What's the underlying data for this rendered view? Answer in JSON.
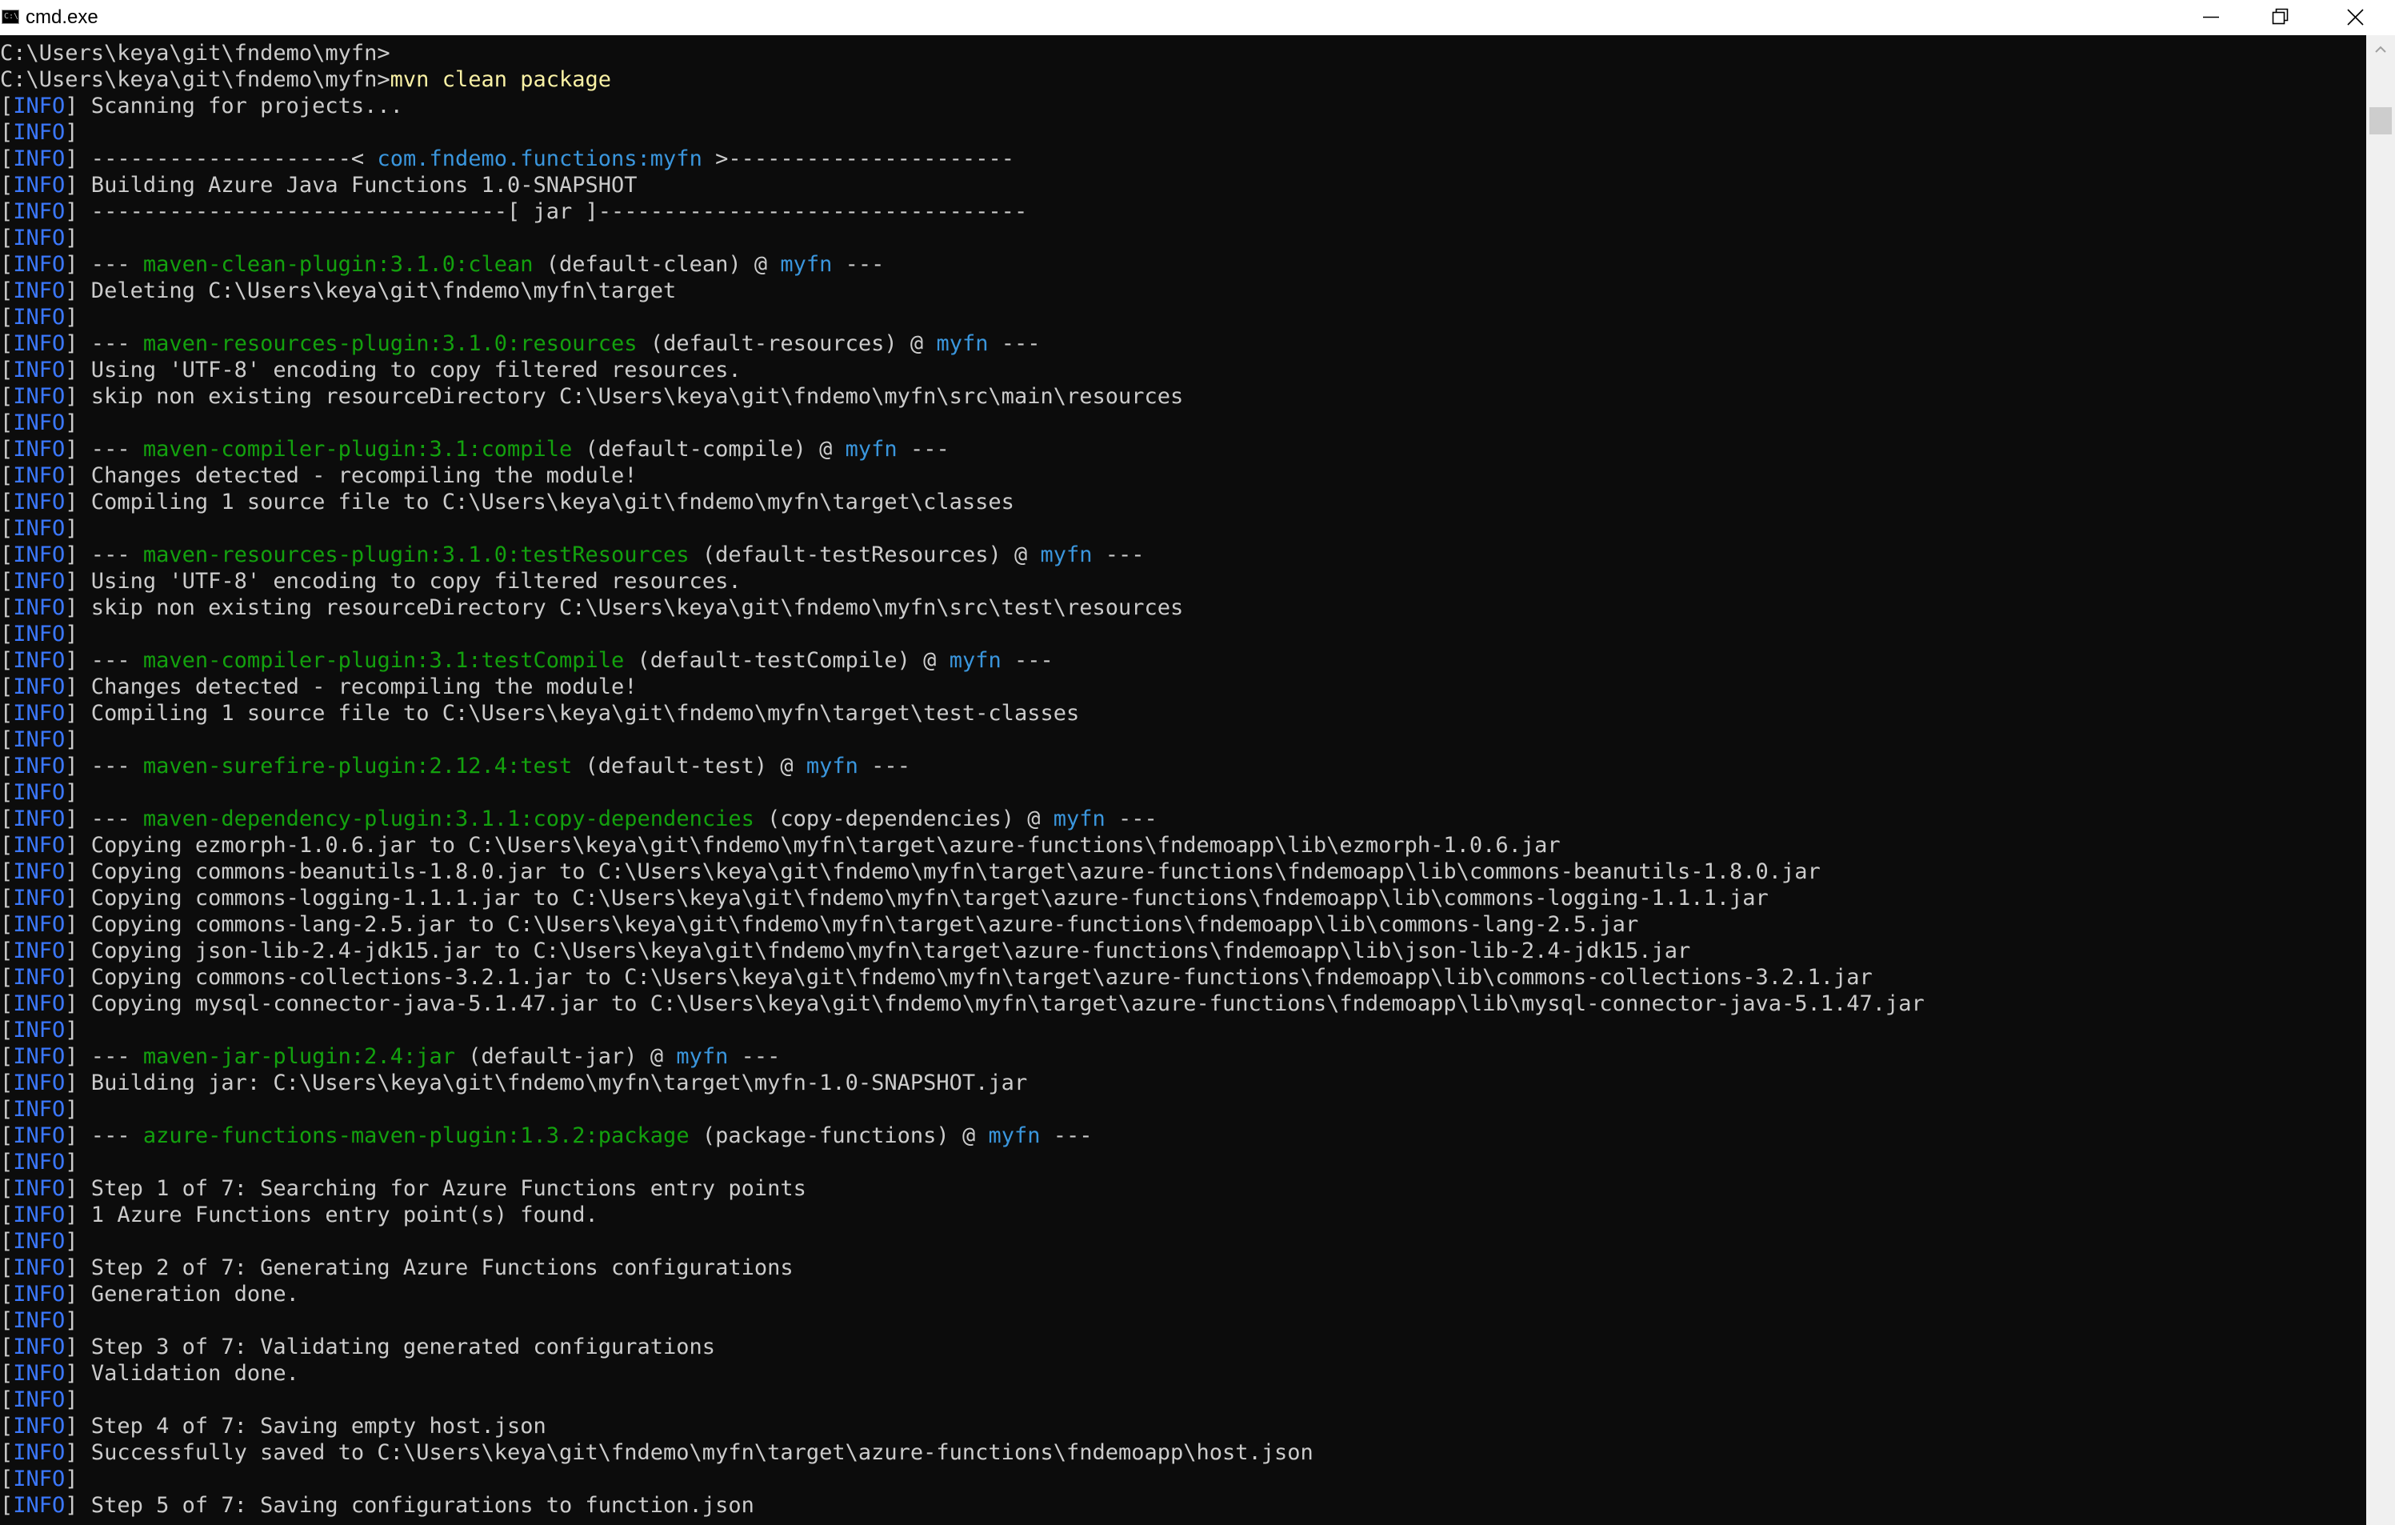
{
  "window": {
    "title": "cmd.exe",
    "icon_label": "C:\\",
    "icon": "console-icon",
    "controls": [
      "minimize-icon",
      "restore-icon",
      "close-icon"
    ]
  },
  "colors": {
    "background": "#0c0c0c",
    "text": "#cccccc",
    "command": "#f9f1a5",
    "info": "#3b78ff",
    "plugin": "#13a10e",
    "artifact": "#3a96dd"
  },
  "terminal": {
    "lines": [
      [
        [
          "prompt",
          "C:\\Users\\keya\\git\\fndemo\\myfn>"
        ]
      ],
      [
        [
          "prompt",
          "C:\\Users\\keya\\git\\fndemo\\myfn>"
        ],
        [
          "cmd",
          "mvn clean package"
        ]
      ],
      [
        [
          "text",
          "["
        ],
        [
          "info",
          "INFO"
        ],
        [
          "text",
          "] Scanning for projects..."
        ]
      ],
      [
        [
          "text",
          "["
        ],
        [
          "info",
          "INFO"
        ],
        [
          "text",
          "]"
        ]
      ],
      [
        [
          "text",
          "["
        ],
        [
          "info",
          "INFO"
        ],
        [
          "text",
          "] --------------------< "
        ],
        [
          "artifact",
          "com.fndemo.functions:myfn"
        ],
        [
          "text",
          " >----------------------"
        ]
      ],
      [
        [
          "text",
          "["
        ],
        [
          "info",
          "INFO"
        ],
        [
          "text",
          "] Building Azure Java Functions 1.0-SNAPSHOT"
        ]
      ],
      [
        [
          "text",
          "["
        ],
        [
          "info",
          "INFO"
        ],
        [
          "text",
          "] --------------------------------[ jar ]---------------------------------"
        ]
      ],
      [
        [
          "text",
          "["
        ],
        [
          "info",
          "INFO"
        ],
        [
          "text",
          "]"
        ]
      ],
      [
        [
          "text",
          "["
        ],
        [
          "info",
          "INFO"
        ],
        [
          "text",
          "] --- "
        ],
        [
          "plugin",
          "maven-clean-plugin:3.1.0:clean"
        ],
        [
          "text",
          " (default-clean) @ "
        ],
        [
          "artifact",
          "myfn"
        ],
        [
          "text",
          " ---"
        ]
      ],
      [
        [
          "text",
          "["
        ],
        [
          "info",
          "INFO"
        ],
        [
          "text",
          "] Deleting C:\\Users\\keya\\git\\fndemo\\myfn\\target"
        ]
      ],
      [
        [
          "text",
          "["
        ],
        [
          "info",
          "INFO"
        ],
        [
          "text",
          "]"
        ]
      ],
      [
        [
          "text",
          "["
        ],
        [
          "info",
          "INFO"
        ],
        [
          "text",
          "] --- "
        ],
        [
          "plugin",
          "maven-resources-plugin:3.1.0:resources"
        ],
        [
          "text",
          " (default-resources) @ "
        ],
        [
          "artifact",
          "myfn"
        ],
        [
          "text",
          " ---"
        ]
      ],
      [
        [
          "text",
          "["
        ],
        [
          "info",
          "INFO"
        ],
        [
          "text",
          "] Using 'UTF-8' encoding to copy filtered resources."
        ]
      ],
      [
        [
          "text",
          "["
        ],
        [
          "info",
          "INFO"
        ],
        [
          "text",
          "] skip non existing resourceDirectory C:\\Users\\keya\\git\\fndemo\\myfn\\src\\main\\resources"
        ]
      ],
      [
        [
          "text",
          "["
        ],
        [
          "info",
          "INFO"
        ],
        [
          "text",
          "]"
        ]
      ],
      [
        [
          "text",
          "["
        ],
        [
          "info",
          "INFO"
        ],
        [
          "text",
          "] --- "
        ],
        [
          "plugin",
          "maven-compiler-plugin:3.1:compile"
        ],
        [
          "text",
          " (default-compile) @ "
        ],
        [
          "artifact",
          "myfn"
        ],
        [
          "text",
          " ---"
        ]
      ],
      [
        [
          "text",
          "["
        ],
        [
          "info",
          "INFO"
        ],
        [
          "text",
          "] Changes detected - recompiling the module!"
        ]
      ],
      [
        [
          "text",
          "["
        ],
        [
          "info",
          "INFO"
        ],
        [
          "text",
          "] Compiling 1 source file to C:\\Users\\keya\\git\\fndemo\\myfn\\target\\classes"
        ]
      ],
      [
        [
          "text",
          "["
        ],
        [
          "info",
          "INFO"
        ],
        [
          "text",
          "]"
        ]
      ],
      [
        [
          "text",
          "["
        ],
        [
          "info",
          "INFO"
        ],
        [
          "text",
          "] --- "
        ],
        [
          "plugin",
          "maven-resources-plugin:3.1.0:testResources"
        ],
        [
          "text",
          " (default-testResources) @ "
        ],
        [
          "artifact",
          "myfn"
        ],
        [
          "text",
          " ---"
        ]
      ],
      [
        [
          "text",
          "["
        ],
        [
          "info",
          "INFO"
        ],
        [
          "text",
          "] Using 'UTF-8' encoding to copy filtered resources."
        ]
      ],
      [
        [
          "text",
          "["
        ],
        [
          "info",
          "INFO"
        ],
        [
          "text",
          "] skip non existing resourceDirectory C:\\Users\\keya\\git\\fndemo\\myfn\\src\\test\\resources"
        ]
      ],
      [
        [
          "text",
          "["
        ],
        [
          "info",
          "INFO"
        ],
        [
          "text",
          "]"
        ]
      ],
      [
        [
          "text",
          "["
        ],
        [
          "info",
          "INFO"
        ],
        [
          "text",
          "] --- "
        ],
        [
          "plugin",
          "maven-compiler-plugin:3.1:testCompile"
        ],
        [
          "text",
          " (default-testCompile) @ "
        ],
        [
          "artifact",
          "myfn"
        ],
        [
          "text",
          " ---"
        ]
      ],
      [
        [
          "text",
          "["
        ],
        [
          "info",
          "INFO"
        ],
        [
          "text",
          "] Changes detected - recompiling the module!"
        ]
      ],
      [
        [
          "text",
          "["
        ],
        [
          "info",
          "INFO"
        ],
        [
          "text",
          "] Compiling 1 source file to C:\\Users\\keya\\git\\fndemo\\myfn\\target\\test-classes"
        ]
      ],
      [
        [
          "text",
          "["
        ],
        [
          "info",
          "INFO"
        ],
        [
          "text",
          "]"
        ]
      ],
      [
        [
          "text",
          "["
        ],
        [
          "info",
          "INFO"
        ],
        [
          "text",
          "] --- "
        ],
        [
          "plugin",
          "maven-surefire-plugin:2.12.4:test"
        ],
        [
          "text",
          " (default-test) @ "
        ],
        [
          "artifact",
          "myfn"
        ],
        [
          "text",
          " ---"
        ]
      ],
      [
        [
          "text",
          "["
        ],
        [
          "info",
          "INFO"
        ],
        [
          "text",
          "]"
        ]
      ],
      [
        [
          "text",
          "["
        ],
        [
          "info",
          "INFO"
        ],
        [
          "text",
          "] --- "
        ],
        [
          "plugin",
          "maven-dependency-plugin:3.1.1:copy-dependencies"
        ],
        [
          "text",
          " (copy-dependencies) @ "
        ],
        [
          "artifact",
          "myfn"
        ],
        [
          "text",
          " ---"
        ]
      ],
      [
        [
          "text",
          "["
        ],
        [
          "info",
          "INFO"
        ],
        [
          "text",
          "] Copying ezmorph-1.0.6.jar to C:\\Users\\keya\\git\\fndemo\\myfn\\target\\azure-functions\\fndemoapp\\lib\\ezmorph-1.0.6.jar"
        ]
      ],
      [
        [
          "text",
          "["
        ],
        [
          "info",
          "INFO"
        ],
        [
          "text",
          "] Copying commons-beanutils-1.8.0.jar to C:\\Users\\keya\\git\\fndemo\\myfn\\target\\azure-functions\\fndemoapp\\lib\\commons-beanutils-1.8.0.jar"
        ]
      ],
      [
        [
          "text",
          "["
        ],
        [
          "info",
          "INFO"
        ],
        [
          "text",
          "] Copying commons-logging-1.1.1.jar to C:\\Users\\keya\\git\\fndemo\\myfn\\target\\azure-functions\\fndemoapp\\lib\\commons-logging-1.1.1.jar"
        ]
      ],
      [
        [
          "text",
          "["
        ],
        [
          "info",
          "INFO"
        ],
        [
          "text",
          "] Copying commons-lang-2.5.jar to C:\\Users\\keya\\git\\fndemo\\myfn\\target\\azure-functions\\fndemoapp\\lib\\commons-lang-2.5.jar"
        ]
      ],
      [
        [
          "text",
          "["
        ],
        [
          "info",
          "INFO"
        ],
        [
          "text",
          "] Copying json-lib-2.4-jdk15.jar to C:\\Users\\keya\\git\\fndemo\\myfn\\target\\azure-functions\\fndemoapp\\lib\\json-lib-2.4-jdk15.jar"
        ]
      ],
      [
        [
          "text",
          "["
        ],
        [
          "info",
          "INFO"
        ],
        [
          "text",
          "] Copying commons-collections-3.2.1.jar to C:\\Users\\keya\\git\\fndemo\\myfn\\target\\azure-functions\\fndemoapp\\lib\\commons-collections-3.2.1.jar"
        ]
      ],
      [
        [
          "text",
          "["
        ],
        [
          "info",
          "INFO"
        ],
        [
          "text",
          "] Copying mysql-connector-java-5.1.47.jar to C:\\Users\\keya\\git\\fndemo\\myfn\\target\\azure-functions\\fndemoapp\\lib\\mysql-connector-java-5.1.47.jar"
        ]
      ],
      [
        [
          "text",
          "["
        ],
        [
          "info",
          "INFO"
        ],
        [
          "text",
          "]"
        ]
      ],
      [
        [
          "text",
          "["
        ],
        [
          "info",
          "INFO"
        ],
        [
          "text",
          "] --- "
        ],
        [
          "plugin",
          "maven-jar-plugin:2.4:jar"
        ],
        [
          "text",
          " (default-jar) @ "
        ],
        [
          "artifact",
          "myfn"
        ],
        [
          "text",
          " ---"
        ]
      ],
      [
        [
          "text",
          "["
        ],
        [
          "info",
          "INFO"
        ],
        [
          "text",
          "] Building jar: C:\\Users\\keya\\git\\fndemo\\myfn\\target\\myfn-1.0-SNAPSHOT.jar"
        ]
      ],
      [
        [
          "text",
          "["
        ],
        [
          "info",
          "INFO"
        ],
        [
          "text",
          "]"
        ]
      ],
      [
        [
          "text",
          "["
        ],
        [
          "info",
          "INFO"
        ],
        [
          "text",
          "] --- "
        ],
        [
          "plugin",
          "azure-functions-maven-plugin:1.3.2:package"
        ],
        [
          "text",
          " (package-functions) @ "
        ],
        [
          "artifact",
          "myfn"
        ],
        [
          "text",
          " ---"
        ]
      ],
      [
        [
          "text",
          "["
        ],
        [
          "info",
          "INFO"
        ],
        [
          "text",
          "]"
        ]
      ],
      [
        [
          "text",
          "["
        ],
        [
          "info",
          "INFO"
        ],
        [
          "text",
          "] Step 1 of 7: Searching for Azure Functions entry points"
        ]
      ],
      [
        [
          "text",
          "["
        ],
        [
          "info",
          "INFO"
        ],
        [
          "text",
          "] 1 Azure Functions entry point(s) found."
        ]
      ],
      [
        [
          "text",
          "["
        ],
        [
          "info",
          "INFO"
        ],
        [
          "text",
          "]"
        ]
      ],
      [
        [
          "text",
          "["
        ],
        [
          "info",
          "INFO"
        ],
        [
          "text",
          "] Step 2 of 7: Generating Azure Functions configurations"
        ]
      ],
      [
        [
          "text",
          "["
        ],
        [
          "info",
          "INFO"
        ],
        [
          "text",
          "] Generation done."
        ]
      ],
      [
        [
          "text",
          "["
        ],
        [
          "info",
          "INFO"
        ],
        [
          "text",
          "]"
        ]
      ],
      [
        [
          "text",
          "["
        ],
        [
          "info",
          "INFO"
        ],
        [
          "text",
          "] Step 3 of 7: Validating generated configurations"
        ]
      ],
      [
        [
          "text",
          "["
        ],
        [
          "info",
          "INFO"
        ],
        [
          "text",
          "] Validation done."
        ]
      ],
      [
        [
          "text",
          "["
        ],
        [
          "info",
          "INFO"
        ],
        [
          "text",
          "]"
        ]
      ],
      [
        [
          "text",
          "["
        ],
        [
          "info",
          "INFO"
        ],
        [
          "text",
          "] Step 4 of 7: Saving empty host.json"
        ]
      ],
      [
        [
          "text",
          "["
        ],
        [
          "info",
          "INFO"
        ],
        [
          "text",
          "] Successfully saved to C:\\Users\\keya\\git\\fndemo\\myfn\\target\\azure-functions\\fndemoapp\\host.json"
        ]
      ],
      [
        [
          "text",
          "["
        ],
        [
          "info",
          "INFO"
        ],
        [
          "text",
          "]"
        ]
      ],
      [
        [
          "text",
          "["
        ],
        [
          "info",
          "INFO"
        ],
        [
          "text",
          "] Step 5 of 7: Saving configurations to function.json"
        ]
      ]
    ]
  }
}
